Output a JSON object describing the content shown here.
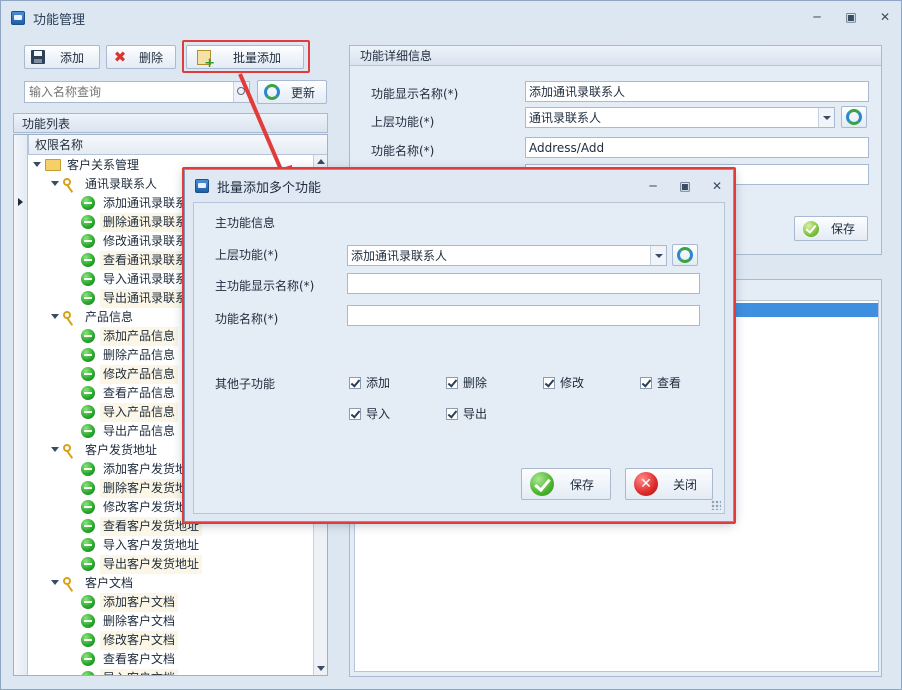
{
  "window": {
    "title": "功能管理",
    "controls": [
      "minimize",
      "maximize",
      "close"
    ]
  },
  "toolbar": {
    "add_label": "添加",
    "delete_label": "删除",
    "batch_add_label": "批量添加",
    "refresh_label": "更新"
  },
  "search": {
    "placeholder": "输入名称查询"
  },
  "tree": {
    "section_title": "功能列表",
    "column_header": "权限名称",
    "rows": [
      {
        "level": 0,
        "icon": "folder-icon",
        "text": "客户关系管理",
        "expand": true
      },
      {
        "level": 1,
        "icon": "key-icon",
        "text": "通讯录联系人",
        "expand": true
      },
      {
        "level": 2,
        "icon": "green-dot-icon",
        "text": "添加通讯录联系人"
      },
      {
        "level": 2,
        "icon": "green-dot-icon",
        "text": "删除通讯录联系人"
      },
      {
        "level": 2,
        "icon": "green-dot-icon",
        "text": "修改通讯录联系人"
      },
      {
        "level": 2,
        "icon": "green-dot-icon",
        "text": "查看通讯录联系人"
      },
      {
        "level": 2,
        "icon": "green-dot-icon",
        "text": "导入通讯录联系人"
      },
      {
        "level": 2,
        "icon": "green-dot-icon",
        "text": "导出通讯录联系人"
      },
      {
        "level": 1,
        "icon": "key-icon",
        "text": "产品信息",
        "expand": true
      },
      {
        "level": 2,
        "icon": "green-dot-icon",
        "text": "添加产品信息"
      },
      {
        "level": 2,
        "icon": "green-dot-icon",
        "text": "删除产品信息"
      },
      {
        "level": 2,
        "icon": "green-dot-icon",
        "text": "修改产品信息"
      },
      {
        "level": 2,
        "icon": "green-dot-icon",
        "text": "查看产品信息"
      },
      {
        "level": 2,
        "icon": "green-dot-icon",
        "text": "导入产品信息"
      },
      {
        "level": 2,
        "icon": "green-dot-icon",
        "text": "导出产品信息"
      },
      {
        "level": 1,
        "icon": "key-icon",
        "text": "客户发货地址",
        "expand": true
      },
      {
        "level": 2,
        "icon": "green-dot-icon",
        "text": "添加客户发货地址"
      },
      {
        "level": 2,
        "icon": "green-dot-icon",
        "text": "删除客户发货地址"
      },
      {
        "level": 2,
        "icon": "green-dot-icon",
        "text": "修改客户发货地址"
      },
      {
        "level": 2,
        "icon": "green-dot-icon",
        "text": "查看客户发货地址"
      },
      {
        "level": 2,
        "icon": "green-dot-icon",
        "text": "导入客户发货地址"
      },
      {
        "level": 2,
        "icon": "green-dot-icon",
        "text": "导出客户发货地址"
      },
      {
        "level": 1,
        "icon": "key-icon",
        "text": "客户文档",
        "expand": true
      },
      {
        "level": 2,
        "icon": "green-dot-icon",
        "text": "添加客户文档"
      },
      {
        "level": 2,
        "icon": "green-dot-icon",
        "text": "删除客户文档"
      },
      {
        "level": 2,
        "icon": "green-dot-icon",
        "text": "修改客户文档"
      },
      {
        "level": 2,
        "icon": "green-dot-icon",
        "text": "查看客户文档"
      },
      {
        "level": 2,
        "icon": "green-dot-icon",
        "text": "导入客户文档"
      }
    ]
  },
  "detail": {
    "section_title": "功能详细信息",
    "display_name_label": "功能显示名称(*)",
    "display_name_value": "添加通讯录联系人",
    "parent_label": "上层功能(*)",
    "parent_value": "通讯录联系人",
    "func_name_label": "功能名称(*)",
    "func_name_value": "Address/Add",
    "save_label": "保存"
  },
  "dialog": {
    "title": "批量添加多个功能",
    "group_title": "主功能信息",
    "parent_label": "上层功能(*)",
    "parent_value": "添加通讯录联系人",
    "main_display_label": "主功能显示名称(*)",
    "main_display_value": "",
    "func_name_label": "功能名称(*)",
    "func_name_value": "",
    "sub_label": "其他子功能",
    "checkboxes": [
      {
        "label": "添加",
        "checked": true
      },
      {
        "label": "删除",
        "checked": true
      },
      {
        "label": "修改",
        "checked": true
      },
      {
        "label": "查看",
        "checked": true
      },
      {
        "label": "导入",
        "checked": true
      },
      {
        "label": "导出",
        "checked": true
      }
    ],
    "save_label": "保存",
    "close_label": "关闭"
  },
  "colors": {
    "highlight": "#e23b3b",
    "selection": "#3f8fe0",
    "window_bg": "#dde7f2"
  }
}
